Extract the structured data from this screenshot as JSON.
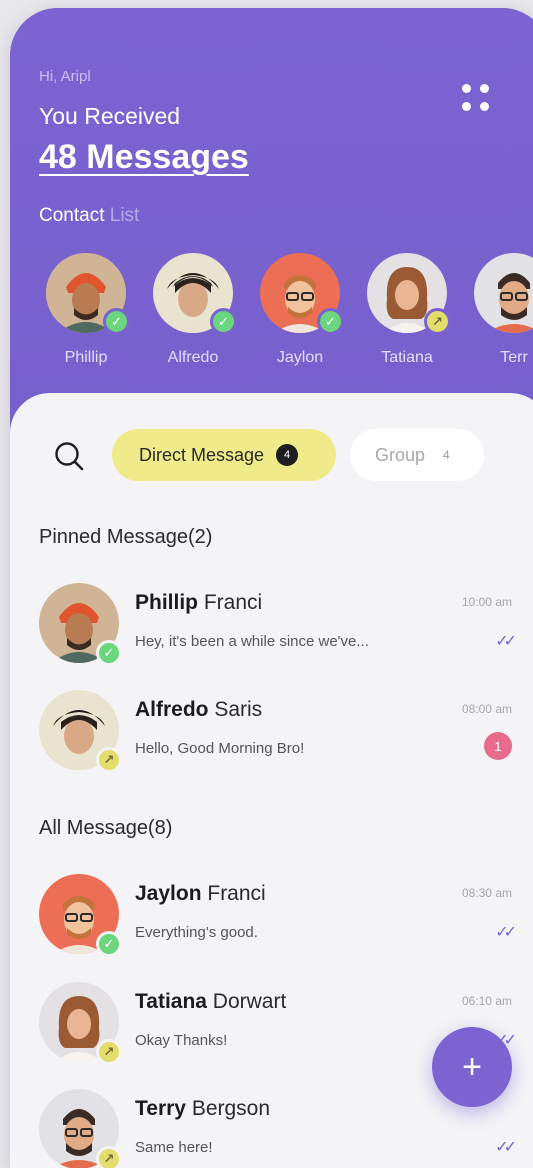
{
  "header": {
    "greeting": "Hi, Aripl",
    "received_label": "You Received",
    "messages_count": "48 Messages",
    "contact_title_bold": "Contact",
    "contact_title_muted": "List"
  },
  "contacts": [
    {
      "name": "Phillip",
      "status": "online"
    },
    {
      "name": "Alfredo",
      "status": "online"
    },
    {
      "name": "Jaylon",
      "status": "online"
    },
    {
      "name": "Tatiana",
      "status": "away"
    },
    {
      "name": "Terr",
      "status": "online"
    }
  ],
  "filters": {
    "direct_label": "Direct Message",
    "direct_count": "4",
    "group_label": "Group",
    "group_count": "4"
  },
  "pinned": {
    "title": "Pinned Message(2)",
    "messages": [
      {
        "first": "Phillip",
        "last": " Franci",
        "preview": "Hey, it's been a while since we've...",
        "time": "10:00 am",
        "status": "online",
        "read": "✓✓"
      },
      {
        "first": "Alfredo",
        "last": " Saris",
        "preview": "Hello, Good Morning Bro!",
        "time": "08:00 am",
        "status": "away",
        "unread": "1"
      }
    ]
  },
  "all": {
    "title": "All Message(8)",
    "messages": [
      {
        "first": "Jaylon",
        "last": " Franci",
        "preview": "Everything's good.",
        "time": "08:30 am",
        "status": "online",
        "read": "✓✓"
      },
      {
        "first": "Tatiana",
        "last": " Dorwart",
        "preview": "Okay Thanks!",
        "time": "06:10 am",
        "status": "away",
        "read": "✓✓"
      },
      {
        "first": "Terry",
        "last": " Bergson",
        "preview": "Same here!",
        "time": "",
        "status": "away",
        "read": "✓✓"
      }
    ]
  },
  "fab_label": "+",
  "colors": {
    "primary": "#7a63cf",
    "yellow_pill": "#efeb8a",
    "online": "#6bd67e",
    "away": "#e3de6b",
    "unread": "#e86b8c"
  }
}
